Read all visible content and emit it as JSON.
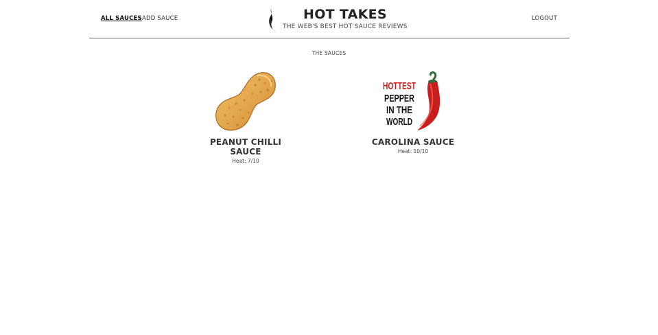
{
  "nav": {
    "all_sauces": "ALL SAUCES",
    "add_sauce": "ADD SAUCE",
    "logout": "LOGOUT"
  },
  "brand": {
    "title": "HOT TAKES",
    "subtitle": "THE WEB'S BEST HOT SAUCE REVIEWS"
  },
  "main": {
    "section_title": "THE SAUCES",
    "sauces": [
      {
        "name_line1": "PEANUT CHILLI",
        "name_line2": "SAUCE",
        "heat": "Heat: 7/10",
        "image": "peanut"
      },
      {
        "name_line1": "CAROLINA SAUCE",
        "name_line2": "",
        "heat": "Heat: 10/10",
        "image": "hottest-pepper"
      }
    ],
    "pepper_image_text": [
      "HOTTEST",
      "PEPPER",
      "IN THE",
      "WORLD"
    ]
  },
  "colors": {
    "accent": "#222222",
    "peanut": "#e3a04b",
    "pepper_red": "#c81e1e",
    "stem_green": "#2f6b3a"
  }
}
